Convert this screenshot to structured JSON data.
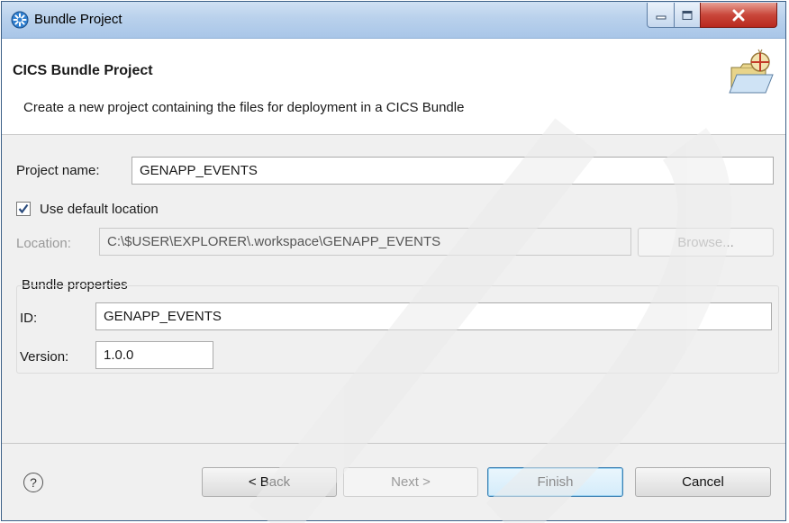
{
  "window": {
    "title": "Bundle Project"
  },
  "header": {
    "title": "CICS Bundle Project",
    "description": "Create a new project containing the files for deployment in a CICS Bundle"
  },
  "form": {
    "project_name_label": "Project name:",
    "project_name_value": "GENAPP_EVENTS",
    "use_default_location_label": "Use default location",
    "use_default_location_checked": true,
    "location_label": "Location:",
    "location_value": "C:\\$USER\\EXPLORER\\.workspace\\GENAPP_EVENTS",
    "browse_label": "Browse..."
  },
  "bundle_properties": {
    "group_label": "Bundle properties",
    "id_label": "ID:",
    "id_value": "GENAPP_EVENTS",
    "version_label": "Version:",
    "version_value": "1.0.0"
  },
  "footer": {
    "help_glyph": "?",
    "back_label": "< Back",
    "next_label": "Next >",
    "finish_label": "Finish",
    "cancel_label": "Cancel"
  },
  "colors": {
    "titlebar": "#b9d1ec",
    "close_button": "#c9473b",
    "watermark": "#ececec"
  },
  "icons": {
    "title": "gear-star-icon",
    "header": "folder-bundle-icon",
    "help": "help-icon",
    "minimize": "minimize-icon",
    "maximize": "maximize-icon",
    "close": "close-icon"
  }
}
